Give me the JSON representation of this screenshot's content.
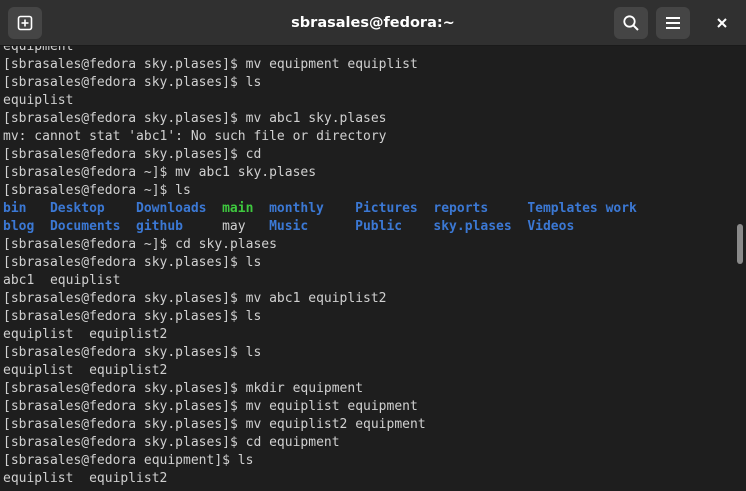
{
  "window": {
    "title": "sbrasales@fedora:~"
  },
  "toolbar": {
    "new_tab_icon": "plus-in-square-icon",
    "search_icon": "magnifier-icon",
    "menu_icon": "hamburger-icon",
    "close_icon": "x-icon"
  },
  "colors": {
    "background": "#1e1e1e",
    "titlebar": "#303030",
    "text": "#d0d0d0",
    "directory": "#3b78d4",
    "executable": "#3ec83e"
  },
  "terminal": {
    "lines_before_ls": [
      "equipment",
      "[sbrasales@fedora sky.plases]$ mv equipment equiplist",
      "[sbrasales@fedora sky.plases]$ ls",
      "equiplist",
      "[sbrasales@fedora sky.plases]$ mv abc1 sky.plases",
      "mv: cannot stat 'abc1': No such file or directory",
      "[sbrasales@fedora sky.plases]$ cd",
      "[sbrasales@fedora ~]$ mv abc1 sky.plases",
      "[sbrasales@fedora ~]$ ls"
    ],
    "ls_rows": [
      [
        {
          "name": "bin",
          "kind": "dir"
        },
        {
          "name": "Desktop",
          "kind": "dir"
        },
        {
          "name": "Downloads",
          "kind": "dir"
        },
        {
          "name": "main",
          "kind": "exec"
        },
        {
          "name": "monthly",
          "kind": "dir"
        },
        {
          "name": "Pictures",
          "kind": "dir"
        },
        {
          "name": "reports",
          "kind": "dir"
        },
        {
          "name": "Templates",
          "kind": "dir"
        },
        {
          "name": "work",
          "kind": "dir"
        }
      ],
      [
        {
          "name": "blog",
          "kind": "dir"
        },
        {
          "name": "Documents",
          "kind": "dir"
        },
        {
          "name": "github",
          "kind": "dir"
        },
        {
          "name": "may",
          "kind": "file"
        },
        {
          "name": "Music",
          "kind": "dir"
        },
        {
          "name": "Public",
          "kind": "dir"
        },
        {
          "name": "sky.plases",
          "kind": "dir"
        },
        {
          "name": "Videos",
          "kind": "dir"
        }
      ]
    ],
    "lines_after_ls": [
      "[sbrasales@fedora ~]$ cd sky.plases",
      "[sbrasales@fedora sky.plases]$ ls",
      "abc1  equiplist",
      "[sbrasales@fedora sky.plases]$ mv abc1 equiplist2",
      "[sbrasales@fedora sky.plases]$ ls",
      "equiplist  equiplist2",
      "[sbrasales@fedora sky.plases]$ ls",
      "equiplist  equiplist2",
      "[sbrasales@fedora sky.plases]$ mkdir equipment",
      "[sbrasales@fedora sky.plases]$ mv equiplist equipment",
      "[sbrasales@fedora sky.plases]$ mv equiplist2 equipment",
      "[sbrasales@fedora sky.plases]$ cd equipment",
      "[sbrasales@fedora equipment]$ ls",
      "equiplist  equiplist2"
    ]
  }
}
